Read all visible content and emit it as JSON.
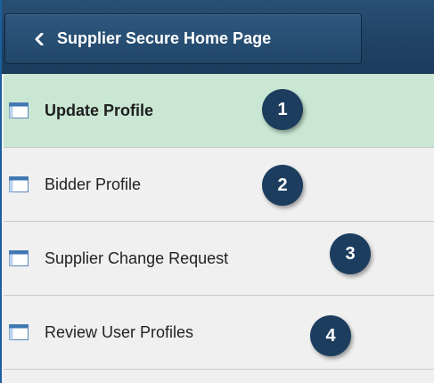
{
  "colors": {
    "header_bg": "#1f4263",
    "selected_row_bg": "#c9e7d3",
    "callout_bg": "#1c3d5e",
    "accent_border": "#1b5f9e"
  },
  "header": {
    "back_icon": "chevron-left-icon",
    "back_label": "Supplier Secure Home Page"
  },
  "menu": {
    "items": [
      {
        "label": "Update Profile",
        "icon": "page-icon",
        "selected": true,
        "callout": "1"
      },
      {
        "label": "Bidder Profile",
        "icon": "page-icon",
        "selected": false,
        "callout": "2"
      },
      {
        "label": "Supplier Change Request",
        "icon": "page-icon",
        "selected": false,
        "callout": "3"
      },
      {
        "label": "Review User Profiles",
        "icon": "page-icon",
        "selected": false,
        "callout": "4"
      }
    ]
  }
}
